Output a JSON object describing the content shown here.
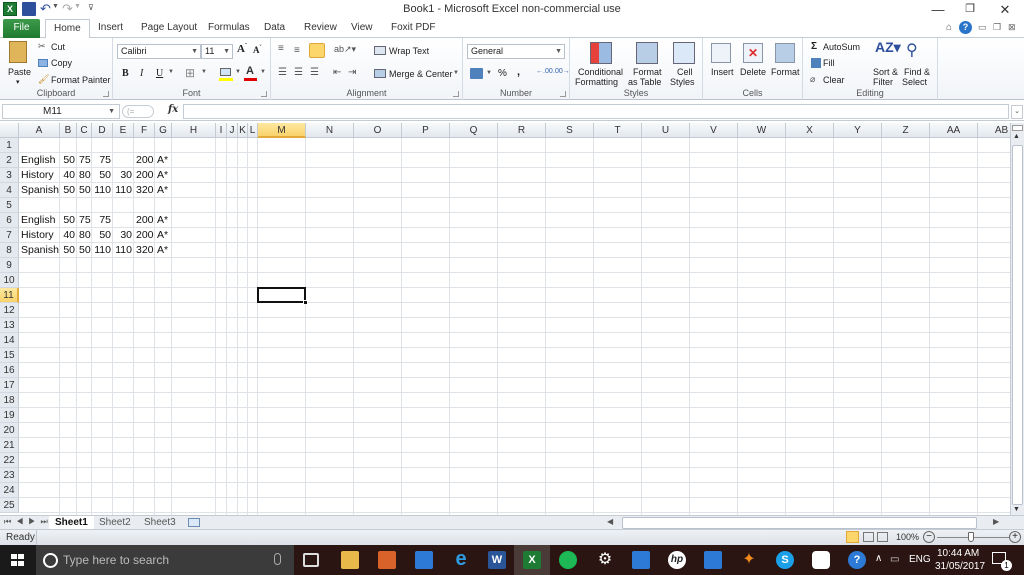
{
  "window": {
    "title": "Book1  -  Microsoft Excel non-commercial use",
    "controls": [
      "minimize",
      "restore",
      "close"
    ]
  },
  "ribbon_tabs": [
    {
      "label": "File",
      "active": false
    },
    {
      "label": "Home",
      "active": true
    },
    {
      "label": "Insert",
      "active": false
    },
    {
      "label": "Page Layout",
      "active": false
    },
    {
      "label": "Formulas",
      "active": false
    },
    {
      "label": "Data",
      "active": false
    },
    {
      "label": "Review",
      "active": false
    },
    {
      "label": "View",
      "active": false
    },
    {
      "label": "Foxit PDF",
      "active": false
    }
  ],
  "ribbon": {
    "clipboard": {
      "label": "Clipboard",
      "paste": "Paste",
      "cut": "Cut",
      "copy": "Copy",
      "format_painter": "Format Painter"
    },
    "font": {
      "label": "Font",
      "font_name": "Calibri",
      "font_size": "11",
      "bold": "B",
      "italic": "I",
      "underline": "U"
    },
    "alignment": {
      "label": "Alignment",
      "wrap_text": "Wrap Text",
      "merge_center": "Merge & Center"
    },
    "number": {
      "label": "Number",
      "format": "General",
      "percent": "%",
      "comma": ","
    },
    "styles": {
      "label": "Styles",
      "conditional_1": "Conditional",
      "conditional_2": "Formatting",
      "format_table_1": "Format",
      "format_table_2": "as Table",
      "cell_styles_1": "Cell",
      "cell_styles_2": "Styles"
    },
    "cells": {
      "label": "Cells",
      "insert": "Insert",
      "delete": "Delete",
      "format": "Format"
    },
    "editing": {
      "label": "Editing",
      "autosum": "AutoSum",
      "fill": "Fill",
      "clear": "Clear",
      "sort_1": "Sort &",
      "sort_2": "Filter",
      "find_1": "Find &",
      "find_2": "Select"
    }
  },
  "formula_bar": {
    "name_box": "M11",
    "fx": "fx",
    "formula": ""
  },
  "grid": {
    "columns": [
      "A",
      "B",
      "C",
      "D",
      "E",
      "F",
      "G",
      "H",
      "I",
      "J",
      "K",
      "L",
      "M",
      "N",
      "O",
      "P",
      "Q",
      "R",
      "S",
      "T",
      "U",
      "V",
      "W",
      "X",
      "Y",
      "Z",
      "AA",
      "AB"
    ],
    "rows": [
      "1",
      "2",
      "3",
      "4",
      "5",
      "6",
      "7",
      "8",
      "9",
      "10",
      "11",
      "12",
      "13",
      "14",
      "15",
      "16",
      "17",
      "18",
      "19",
      "20",
      "21",
      "22",
      "23",
      "24",
      "25"
    ],
    "selected_cell": "M11",
    "cells": [
      {
        "ref": "A2",
        "value": "English"
      },
      {
        "ref": "B2",
        "value": "50"
      },
      {
        "ref": "C2",
        "value": "75"
      },
      {
        "ref": "D2",
        "value": "75"
      },
      {
        "ref": "F2",
        "value": "200"
      },
      {
        "ref": "G2",
        "value": "A*"
      },
      {
        "ref": "A3",
        "value": "History"
      },
      {
        "ref": "B3",
        "value": "40"
      },
      {
        "ref": "C3",
        "value": "80"
      },
      {
        "ref": "D3",
        "value": "50"
      },
      {
        "ref": "E3",
        "value": "30"
      },
      {
        "ref": "F3",
        "value": "200"
      },
      {
        "ref": "G3",
        "value": "A*"
      },
      {
        "ref": "A4",
        "value": "Spanish"
      },
      {
        "ref": "B4",
        "value": "50"
      },
      {
        "ref": "C4",
        "value": "50"
      },
      {
        "ref": "D4",
        "value": "110"
      },
      {
        "ref": "E4",
        "value": "110"
      },
      {
        "ref": "F4",
        "value": "320"
      },
      {
        "ref": "G4",
        "value": "A*"
      },
      {
        "ref": "A6",
        "value": "English"
      },
      {
        "ref": "B6",
        "value": "50"
      },
      {
        "ref": "C6",
        "value": "75"
      },
      {
        "ref": "D6",
        "value": "75"
      },
      {
        "ref": "F6",
        "value": "200"
      },
      {
        "ref": "G6",
        "value": "A*"
      },
      {
        "ref": "A7",
        "value": "History"
      },
      {
        "ref": "B7",
        "value": "40"
      },
      {
        "ref": "C7",
        "value": "80"
      },
      {
        "ref": "D7",
        "value": "50"
      },
      {
        "ref": "E7",
        "value": "30"
      },
      {
        "ref": "F7",
        "value": "200"
      },
      {
        "ref": "G7",
        "value": "A*"
      },
      {
        "ref": "A8",
        "value": "Spanish"
      },
      {
        "ref": "B8",
        "value": "50"
      },
      {
        "ref": "C8",
        "value": "50"
      },
      {
        "ref": "D8",
        "value": "110"
      },
      {
        "ref": "E8",
        "value": "110"
      },
      {
        "ref": "F8",
        "value": "320"
      },
      {
        "ref": "G8",
        "value": "A*"
      }
    ]
  },
  "sheet_tabs": [
    {
      "label": "Sheet1",
      "active": true
    },
    {
      "label": "Sheet2",
      "active": false
    },
    {
      "label": "Sheet3",
      "active": false
    }
  ],
  "status_bar": {
    "status": "Ready",
    "zoom": "100%"
  },
  "taskbar": {
    "search_placeholder": "Type here to search",
    "language": "ENG",
    "time": "10:44 AM",
    "date": "31/05/2017",
    "notification_count": "1",
    "apps": [
      "task-view",
      "file-explorer",
      "app-orange",
      "app-blue-edit",
      "edge",
      "word",
      "excel",
      "spotify",
      "settings",
      "onedrive-photos",
      "hp",
      "scanner",
      "butterfly",
      "skype",
      "onedrive",
      "help"
    ]
  }
}
